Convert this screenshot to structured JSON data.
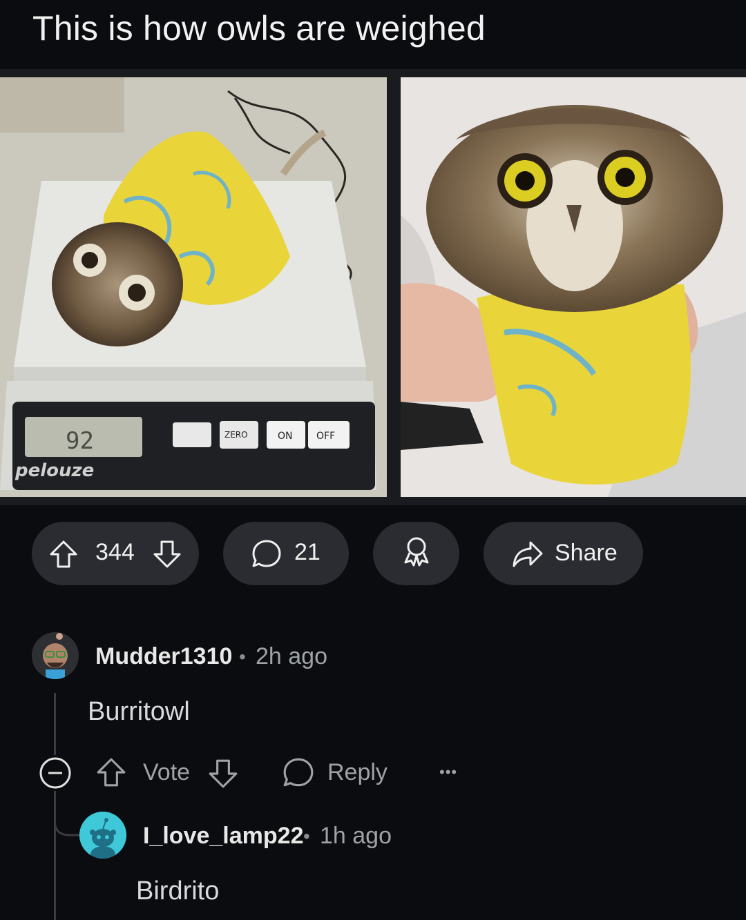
{
  "post": {
    "title": "This is how owls are weighed",
    "images": [
      {
        "alt": "owl-wrapped-on-scale",
        "scale_brand": "pelouze",
        "scale_readout": "92",
        "buttons": [
          "ZERO",
          "ON",
          "OFF"
        ]
      },
      {
        "alt": "owl-wrapped-in-hand"
      }
    ]
  },
  "actions": {
    "upvotes": "344",
    "comments": "21",
    "share_label": "Share"
  },
  "comments": [
    {
      "username": "Mudder1310",
      "separator": "•",
      "time": "2h ago",
      "text": "Burritowl",
      "vote_label": "Vote",
      "reply_label": "Reply",
      "more": "•••"
    },
    {
      "username": "I_love_lamp22",
      "separator": "•",
      "time": "1h ago",
      "text": "Birdrito"
    }
  ],
  "colors": {
    "background": "#0b0c0f",
    "pill": "#2a2c31",
    "yellow_wrap": "#e8d23a",
    "avatar_teal": "#3fc9d8"
  }
}
